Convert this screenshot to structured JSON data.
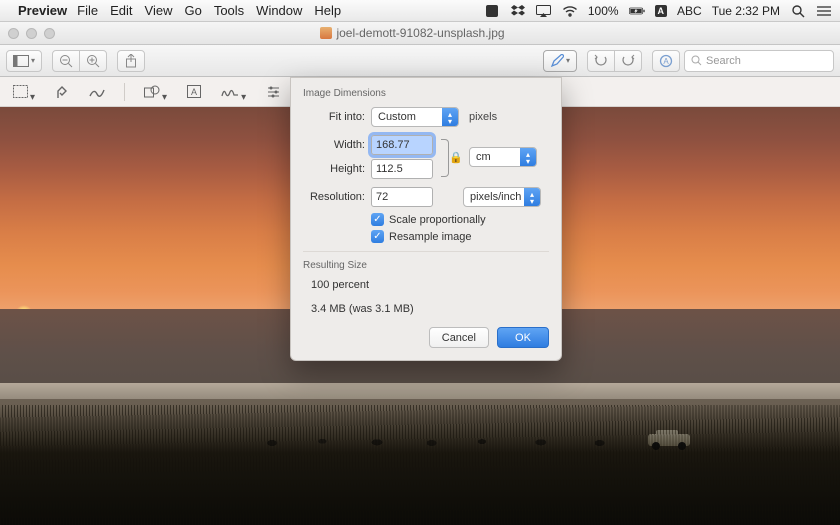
{
  "menubar": {
    "app": "Preview",
    "items": [
      "File",
      "Edit",
      "View",
      "Go",
      "Tools",
      "Window",
      "Help"
    ],
    "battery": "100%",
    "input_badge": "ABC",
    "clock": "Tue 2:32 PM"
  },
  "window": {
    "title": "joel-demott-91082-unsplash.jpg"
  },
  "toolbar": {
    "search_placeholder": "Search"
  },
  "dialog": {
    "section1_title": "Image Dimensions",
    "fit_label": "Fit into:",
    "fit_value": "Custom",
    "fit_units": "pixels",
    "width_label": "Width:",
    "width_value": "168.77",
    "height_label": "Height:",
    "height_value": "112.5",
    "size_unit": "cm",
    "resolution_label": "Resolution:",
    "resolution_value": "72",
    "resolution_unit": "pixels/inch",
    "scale_label": "Scale proportionally",
    "resample_label": "Resample image",
    "section2_title": "Resulting Size",
    "percent_line": "100 percent",
    "size_line": "3.4 MB (was 3.1 MB)",
    "cancel": "Cancel",
    "ok": "OK"
  }
}
